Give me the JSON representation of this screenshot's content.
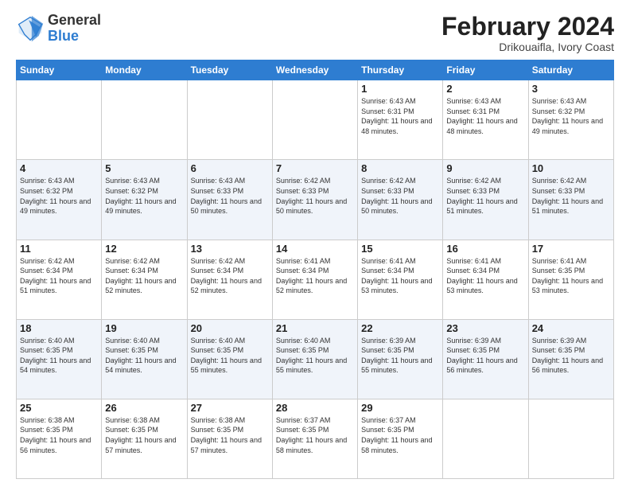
{
  "header": {
    "logo_general": "General",
    "logo_blue": "Blue",
    "title": "February 2024",
    "subtitle": "Drikouaifla, Ivory Coast"
  },
  "days_of_week": [
    "Sunday",
    "Monday",
    "Tuesday",
    "Wednesday",
    "Thursday",
    "Friday",
    "Saturday"
  ],
  "weeks": [
    [
      {
        "day": "",
        "info": ""
      },
      {
        "day": "",
        "info": ""
      },
      {
        "day": "",
        "info": ""
      },
      {
        "day": "",
        "info": ""
      },
      {
        "day": "1",
        "info": "Sunrise: 6:43 AM\nSunset: 6:31 PM\nDaylight: 11 hours\nand 48 minutes."
      },
      {
        "day": "2",
        "info": "Sunrise: 6:43 AM\nSunset: 6:31 PM\nDaylight: 11 hours\nand 48 minutes."
      },
      {
        "day": "3",
        "info": "Sunrise: 6:43 AM\nSunset: 6:32 PM\nDaylight: 11 hours\nand 49 minutes."
      }
    ],
    [
      {
        "day": "4",
        "info": "Sunrise: 6:43 AM\nSunset: 6:32 PM\nDaylight: 11 hours\nand 49 minutes."
      },
      {
        "day": "5",
        "info": "Sunrise: 6:43 AM\nSunset: 6:32 PM\nDaylight: 11 hours\nand 49 minutes."
      },
      {
        "day": "6",
        "info": "Sunrise: 6:43 AM\nSunset: 6:33 PM\nDaylight: 11 hours\nand 50 minutes."
      },
      {
        "day": "7",
        "info": "Sunrise: 6:42 AM\nSunset: 6:33 PM\nDaylight: 11 hours\nand 50 minutes."
      },
      {
        "day": "8",
        "info": "Sunrise: 6:42 AM\nSunset: 6:33 PM\nDaylight: 11 hours\nand 50 minutes."
      },
      {
        "day": "9",
        "info": "Sunrise: 6:42 AM\nSunset: 6:33 PM\nDaylight: 11 hours\nand 51 minutes."
      },
      {
        "day": "10",
        "info": "Sunrise: 6:42 AM\nSunset: 6:33 PM\nDaylight: 11 hours\nand 51 minutes."
      }
    ],
    [
      {
        "day": "11",
        "info": "Sunrise: 6:42 AM\nSunset: 6:34 PM\nDaylight: 11 hours\nand 51 minutes."
      },
      {
        "day": "12",
        "info": "Sunrise: 6:42 AM\nSunset: 6:34 PM\nDaylight: 11 hours\nand 52 minutes."
      },
      {
        "day": "13",
        "info": "Sunrise: 6:42 AM\nSunset: 6:34 PM\nDaylight: 11 hours\nand 52 minutes."
      },
      {
        "day": "14",
        "info": "Sunrise: 6:41 AM\nSunset: 6:34 PM\nDaylight: 11 hours\nand 52 minutes."
      },
      {
        "day": "15",
        "info": "Sunrise: 6:41 AM\nSunset: 6:34 PM\nDaylight: 11 hours\nand 53 minutes."
      },
      {
        "day": "16",
        "info": "Sunrise: 6:41 AM\nSunset: 6:34 PM\nDaylight: 11 hours\nand 53 minutes."
      },
      {
        "day": "17",
        "info": "Sunrise: 6:41 AM\nSunset: 6:35 PM\nDaylight: 11 hours\nand 53 minutes."
      }
    ],
    [
      {
        "day": "18",
        "info": "Sunrise: 6:40 AM\nSunset: 6:35 PM\nDaylight: 11 hours\nand 54 minutes."
      },
      {
        "day": "19",
        "info": "Sunrise: 6:40 AM\nSunset: 6:35 PM\nDaylight: 11 hours\nand 54 minutes."
      },
      {
        "day": "20",
        "info": "Sunrise: 6:40 AM\nSunset: 6:35 PM\nDaylight: 11 hours\nand 55 minutes."
      },
      {
        "day": "21",
        "info": "Sunrise: 6:40 AM\nSunset: 6:35 PM\nDaylight: 11 hours\nand 55 minutes."
      },
      {
        "day": "22",
        "info": "Sunrise: 6:39 AM\nSunset: 6:35 PM\nDaylight: 11 hours\nand 55 minutes."
      },
      {
        "day": "23",
        "info": "Sunrise: 6:39 AM\nSunset: 6:35 PM\nDaylight: 11 hours\nand 56 minutes."
      },
      {
        "day": "24",
        "info": "Sunrise: 6:39 AM\nSunset: 6:35 PM\nDaylight: 11 hours\nand 56 minutes."
      }
    ],
    [
      {
        "day": "25",
        "info": "Sunrise: 6:38 AM\nSunset: 6:35 PM\nDaylight: 11 hours\nand 56 minutes."
      },
      {
        "day": "26",
        "info": "Sunrise: 6:38 AM\nSunset: 6:35 PM\nDaylight: 11 hours\nand 57 minutes."
      },
      {
        "day": "27",
        "info": "Sunrise: 6:38 AM\nSunset: 6:35 PM\nDaylight: 11 hours\nand 57 minutes."
      },
      {
        "day": "28",
        "info": "Sunrise: 6:37 AM\nSunset: 6:35 PM\nDaylight: 11 hours\nand 58 minutes."
      },
      {
        "day": "29",
        "info": "Sunrise: 6:37 AM\nSunset: 6:35 PM\nDaylight: 11 hours\nand 58 minutes."
      },
      {
        "day": "",
        "info": ""
      },
      {
        "day": "",
        "info": ""
      }
    ]
  ]
}
